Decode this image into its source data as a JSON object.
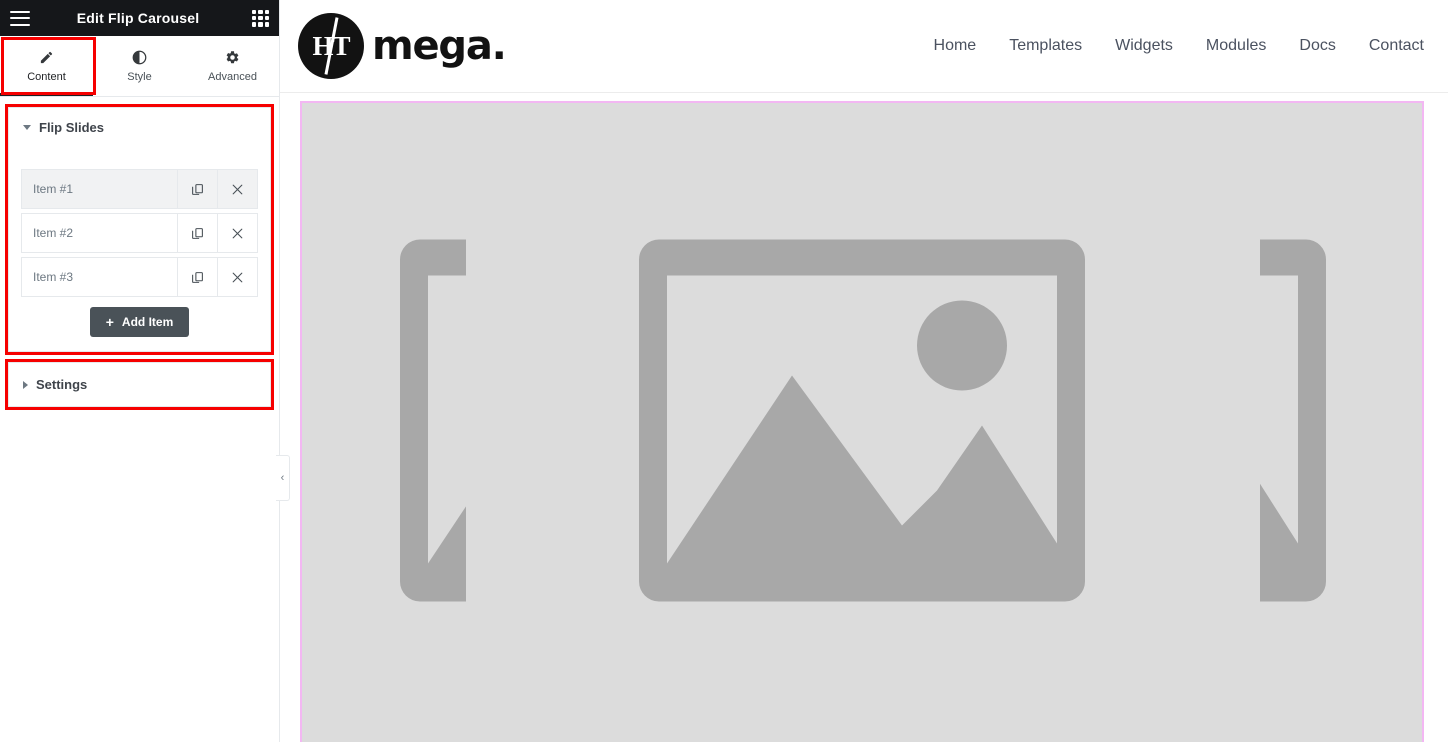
{
  "panel": {
    "title": "Edit Flip Carousel",
    "menu_icon": "hamburger-icon",
    "apps_icon": "grid-apps-icon",
    "tabs": [
      {
        "label": "Content",
        "icon": "pencil-icon",
        "active": true
      },
      {
        "label": "Style",
        "icon": "contrast-icon",
        "active": false
      },
      {
        "label": "Advanced",
        "icon": "gear-icon",
        "active": false
      }
    ],
    "sections": [
      {
        "title": "Flip Slides",
        "expanded": true,
        "highlighted": true,
        "items": [
          {
            "label": "Item #1",
            "selected": true
          },
          {
            "label": "Item #2",
            "selected": false
          },
          {
            "label": "Item #3",
            "selected": false
          }
        ],
        "add_button": {
          "label": "Add Item",
          "plus": "+"
        }
      },
      {
        "title": "Settings",
        "expanded": false,
        "highlighted": true
      }
    ],
    "collapse_handle": "‹",
    "row_icons": {
      "duplicate": "duplicate-icon",
      "remove": "close-icon"
    }
  },
  "preview": {
    "brand": {
      "mark_text": "HT",
      "word": "mega."
    },
    "nav": [
      {
        "label": "Home"
      },
      {
        "label": "Templates"
      },
      {
        "label": "Widgets"
      },
      {
        "label": "Modules"
      },
      {
        "label": "Docs"
      },
      {
        "label": "Contact"
      }
    ],
    "canvas": {
      "background_color": "#dcdcdc",
      "border_color": "#f3b7f3",
      "placeholder_color": "#a8a8a8",
      "slides": [
        {
          "name": "slide-left",
          "content": "image-placeholder-icon"
        },
        {
          "name": "slide-center",
          "content": "image-placeholder-icon"
        },
        {
          "name": "slide-right",
          "content": "image-placeholder-icon"
        }
      ]
    }
  },
  "highlight_color": "#f60000"
}
